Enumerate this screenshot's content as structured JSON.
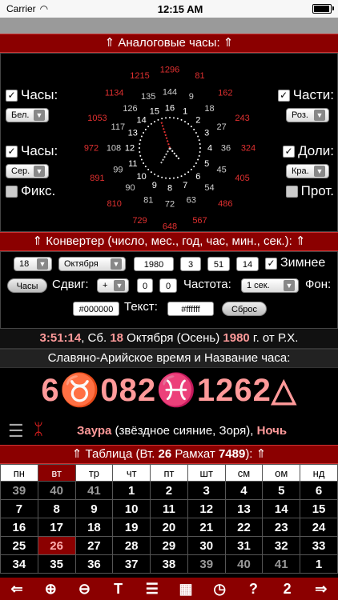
{
  "status": {
    "carrier": "Carrier",
    "time": "12:15 AM"
  },
  "analog": {
    "header": "⇑ Аналоговые часы: ⇑",
    "left": {
      "hours_label": "Часы:",
      "hours_color": "Бел.",
      "hours2_label": "Часы:",
      "hours2_color": "Сер.",
      "fix_label": "Фикс."
    },
    "right": {
      "parts_label": "Части:",
      "parts_color": "Роз.",
      "doli_label": "Доли:",
      "doli_color": "Кра.",
      "prot_label": "Прот."
    },
    "outer_ring": [
      "1296",
      "81",
      "162",
      "243",
      "324",
      "405",
      "486",
      "567",
      "648",
      "729",
      "810",
      "891",
      "972",
      "1053",
      "1134",
      "1215"
    ],
    "middle_ring": [
      "144",
      "9",
      "18",
      "27",
      "36",
      "45",
      "54",
      "63",
      "72",
      "81",
      "90",
      "99",
      "108",
      "117",
      "126",
      "135"
    ],
    "inner_ring": [
      "16",
      "1",
      "2",
      "3",
      "4",
      "5",
      "6",
      "7",
      "8",
      "9",
      "10",
      "11",
      "12",
      "13",
      "14",
      "15"
    ]
  },
  "converter": {
    "header": "⇑ Конвертер (число, мес., год, час, мин., сек.): ⇑",
    "day": "18",
    "month": "Октября",
    "year": "1980",
    "hour": "3",
    "minute": "51",
    "second": "14",
    "winter_label": "Зимнее",
    "hours_button": "Часы",
    "shift_label": "Сдвиг:",
    "shift_sign": "+",
    "shift1": "0",
    "shift2": "0",
    "freq_label": "Частота:",
    "freq_value": "1 сек.",
    "bg_label": "Фон:",
    "bg_value": "#000000",
    "text_label": "Текст:",
    "text_value": "#ffffff",
    "reset_button": "Сброс"
  },
  "dateline": {
    "time": "3:51:14",
    "wd": ", Сб. ",
    "day": "18",
    "mid": " Октября (Осень) ",
    "year": "1980",
    "tail": " г. от Р.Х."
  },
  "slav": {
    "header": "Славяно-Арийское время и Название часа:",
    "big": "6♉082♓1262△",
    "hour_name": "Заура",
    "hour_desc": " (звёздное сияние, Зоря), ",
    "hour_period": "Ночь"
  },
  "table": {
    "header_pre": "⇑ Таблица (Вт. ",
    "header_num": "26",
    "header_mid": " Рамхат ",
    "header_year": "7489",
    "header_post": "): ⇑",
    "weekdays": [
      "пн",
      "вт",
      "тр",
      "чт",
      "пт",
      "шт",
      "см",
      "ом",
      "нд"
    ],
    "rows": [
      [
        "39",
        "40",
        "41",
        "1",
        "2",
        "3",
        "4",
        "5",
        "6"
      ],
      [
        "7",
        "8",
        "9",
        "10",
        "11",
        "12",
        "13",
        "14",
        "15"
      ],
      [
        "16",
        "17",
        "18",
        "19",
        "20",
        "21",
        "22",
        "23",
        "24"
      ],
      [
        "25",
        "26",
        "27",
        "28",
        "29",
        "30",
        "31",
        "32",
        "33"
      ],
      [
        "34",
        "35",
        "36",
        "37",
        "38",
        "39",
        "40",
        "41",
        "1"
      ]
    ]
  },
  "toolbar": [
    "⇐",
    "⊕",
    "⊖",
    "T",
    "☰",
    "▦",
    "◷",
    "?",
    "2",
    "⇒"
  ]
}
